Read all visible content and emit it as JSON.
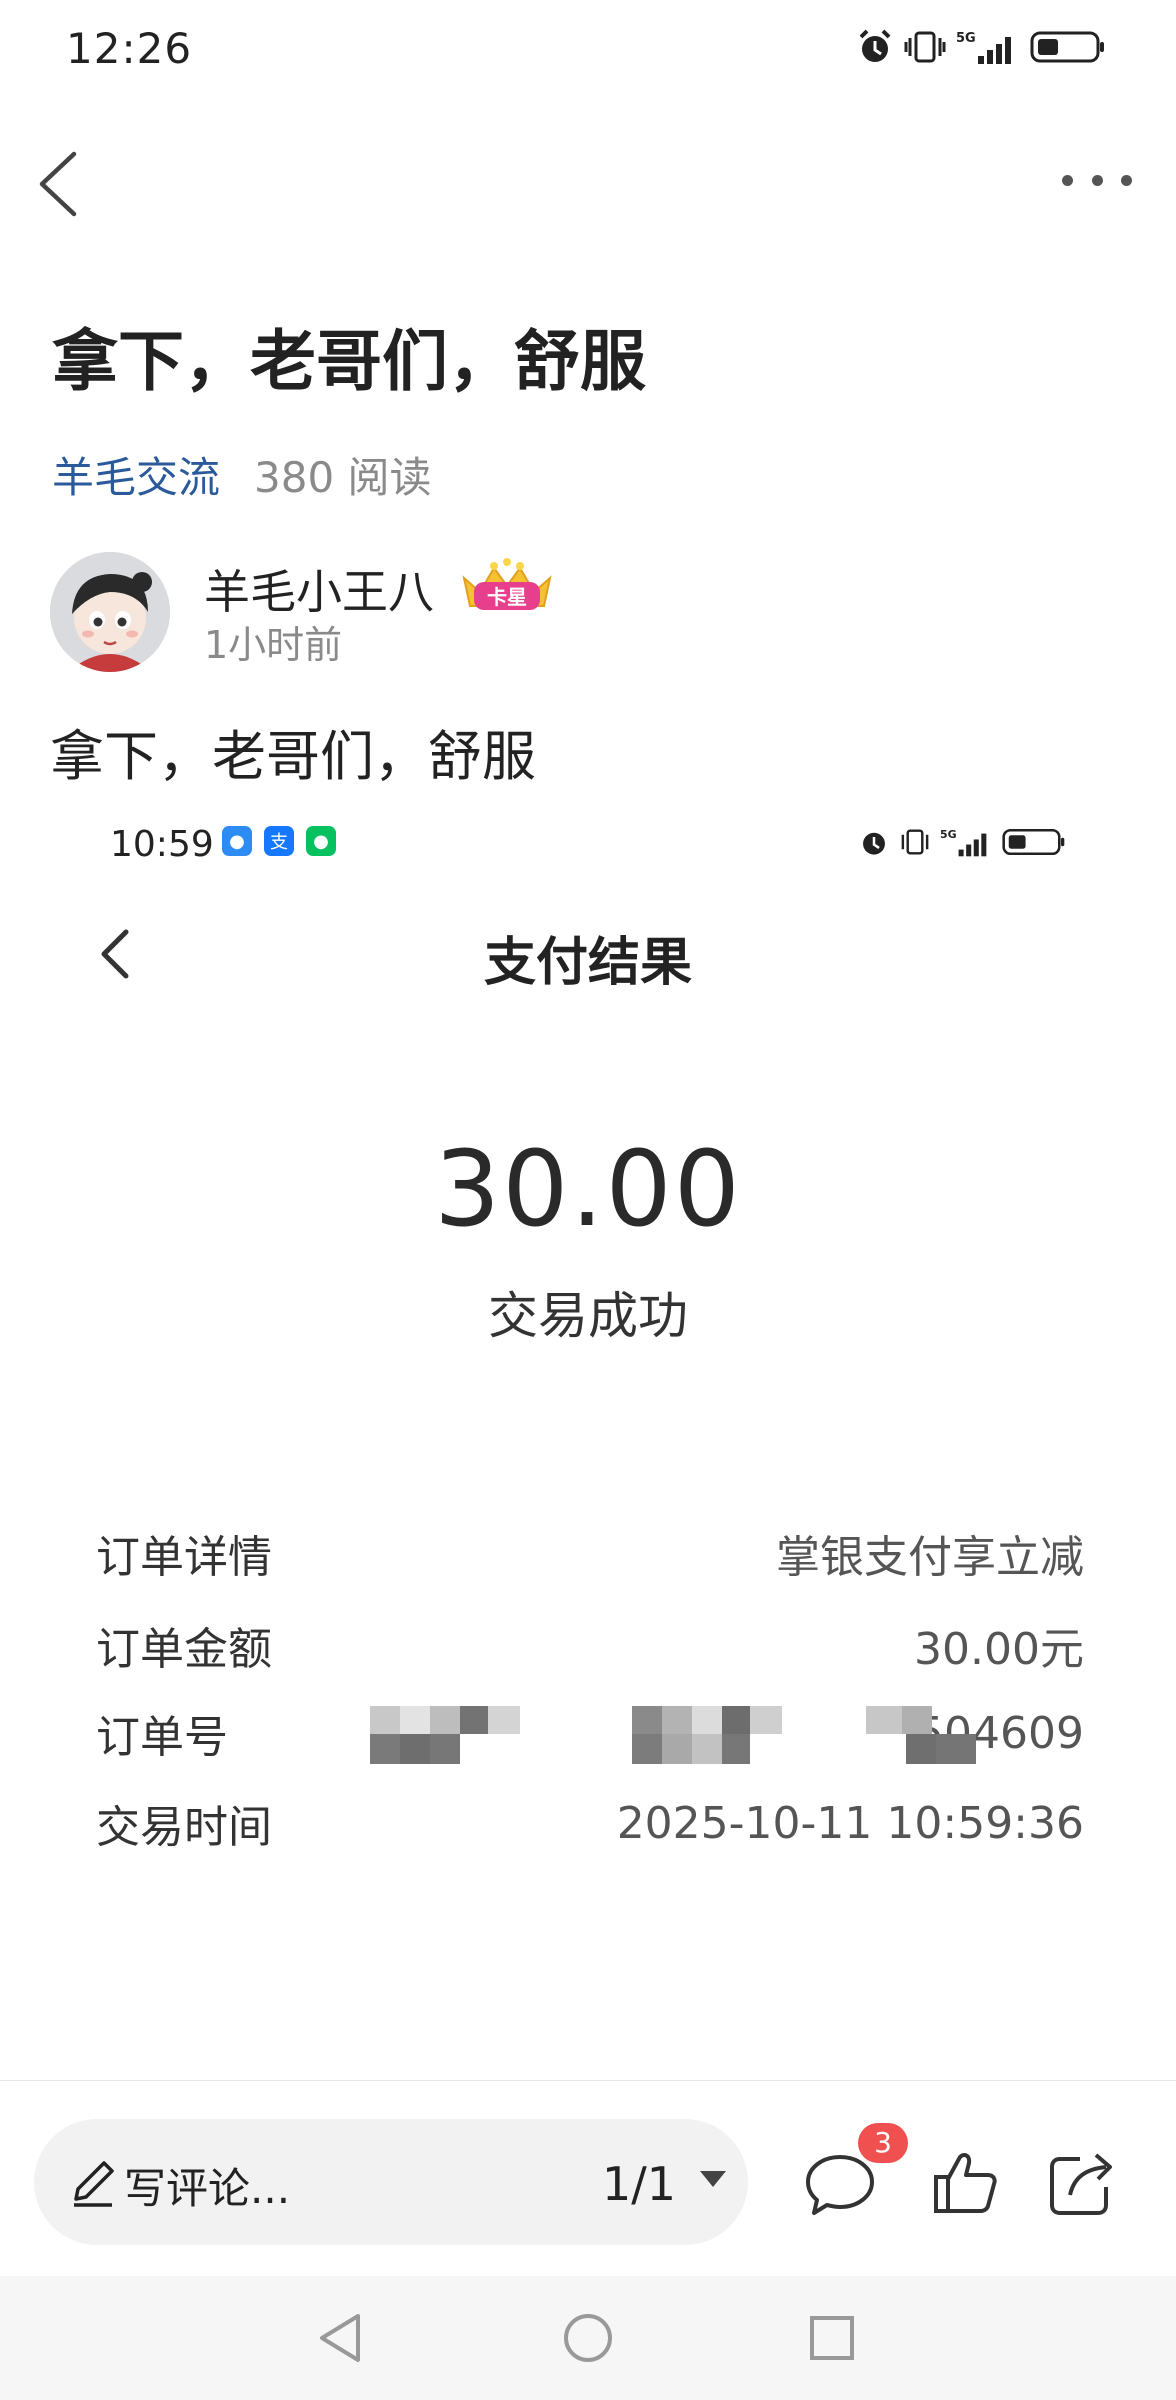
{
  "status_bar": {
    "time": "12:26"
  },
  "nav": {
    "back_icon": "back-arrow-icon",
    "more_icon": "more-dots-icon"
  },
  "post": {
    "title": "拿下，老哥们，舒服",
    "board": "羊毛交流",
    "reads": "380 阅读",
    "author": "羊毛小王八",
    "author_badge": "卡星",
    "time_ago": "1小时前",
    "body": "拿下，老哥们，舒服"
  },
  "screenshot": {
    "time": "10:59",
    "title": "支付结果",
    "amount": "30.00",
    "status": "交易成功",
    "rows": [
      {
        "label": "订单详情",
        "value": "掌银支付享立减"
      },
      {
        "label": "订单金额",
        "value": "30.00元"
      },
      {
        "label": "订单号",
        "value": "504609"
      },
      {
        "label": "交易时间",
        "value": "2025-10-11 10:59:36"
      }
    ]
  },
  "action_bar": {
    "comment_placeholder": "写评论...",
    "page_indicator": "1/1",
    "comment_count": "3",
    "accent": "#f0504f"
  }
}
